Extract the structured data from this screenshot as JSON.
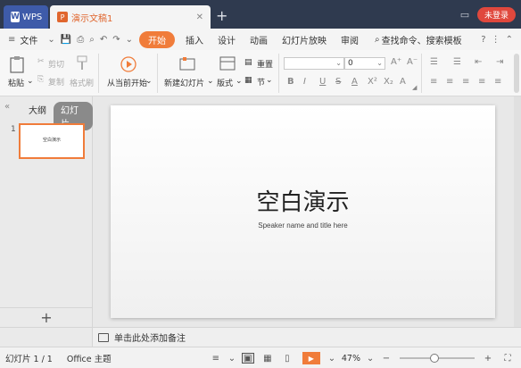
{
  "titlebar": {
    "wps_tab": "WPS",
    "doc_tab": "演示文稿1",
    "new_tab": "+",
    "login": "未登录"
  },
  "menubar": {
    "file_menu": "文件",
    "tabs": [
      "开始",
      "插入",
      "设计",
      "动画",
      "幻灯片放映",
      "审阅"
    ],
    "active_tab": "开始",
    "search": "查找命令、搜索模板",
    "help": "?"
  },
  "ribbon": {
    "paste": "粘贴",
    "cut": "剪切",
    "copy": "复制",
    "format_painter": "格式刷",
    "from_current": "从当前开始",
    "new_slide": "新建幻灯片",
    "layout": "版式",
    "reset": "重置",
    "section": "节",
    "font_name": "",
    "font_size": "0",
    "font_buttons": [
      "B",
      "I",
      "U",
      "S",
      "A",
      "X²",
      "X₂",
      "A"
    ],
    "size_grow": "A⁺",
    "size_shrink": "A⁻"
  },
  "left_panel": {
    "outline_tab": "大纲",
    "slides_tab": "幻灯片",
    "slide_number": "1",
    "thumb_title": "空白演示",
    "add_slide": "+"
  },
  "slide": {
    "title": "空白演示",
    "subtitle": "Speaker name and title here"
  },
  "notes": {
    "placeholder": "单击此处添加备注"
  },
  "status": {
    "slide_info": "幻灯片 1 / 1",
    "theme": "Office 主题",
    "zoom": "47%",
    "zoom_level": 0.47
  },
  "colors": {
    "accent": "#f07c3a",
    "titlebar": "#2f3a4f",
    "login": "#e0483d"
  }
}
